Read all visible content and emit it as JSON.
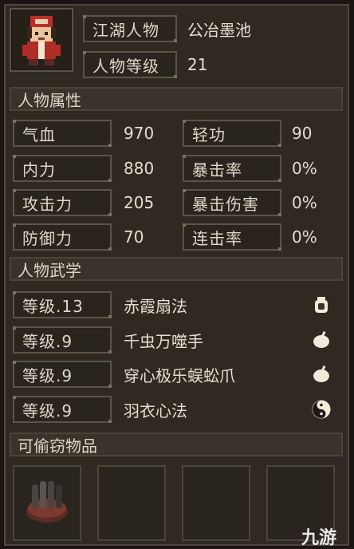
{
  "character": {
    "name_label": "江湖人物",
    "name": "公冶墨池",
    "level_label": "人物等级",
    "level": "21"
  },
  "attributes": {
    "title": "人物属性",
    "rows": [
      {
        "label": "气血",
        "value": "970",
        "label2": "轻功",
        "value2": "90"
      },
      {
        "label": "内力",
        "value": "880",
        "label2": "暴击率",
        "value2": "0%"
      },
      {
        "label": "攻击力",
        "value": "205",
        "label2": "暴击伤害",
        "value2": "0%"
      },
      {
        "label": "防御力",
        "value": "70",
        "label2": "连击率",
        "value2": "0%"
      }
    ]
  },
  "martial": {
    "title": "人物武学",
    "skills": [
      {
        "level": "等级.13",
        "name": "赤霞扇法",
        "icon": "bottle-icon"
      },
      {
        "level": "等级.9",
        "name": "千虫万噬手",
        "icon": "fist-icon"
      },
      {
        "level": "等级.9",
        "name": "穿心极乐蜈蚣爪",
        "icon": "fist-icon"
      },
      {
        "level": "等级.9",
        "name": "羽衣心法",
        "icon": "yin-yang-icon"
      }
    ]
  },
  "steal": {
    "title": "可偷窃物品",
    "slots": [
      "armor-item",
      "empty",
      "empty",
      "empty"
    ]
  },
  "watermark": "九游",
  "colors": {
    "bg": "#302922",
    "border": "#5a5147",
    "text": "#e0d6c8"
  }
}
